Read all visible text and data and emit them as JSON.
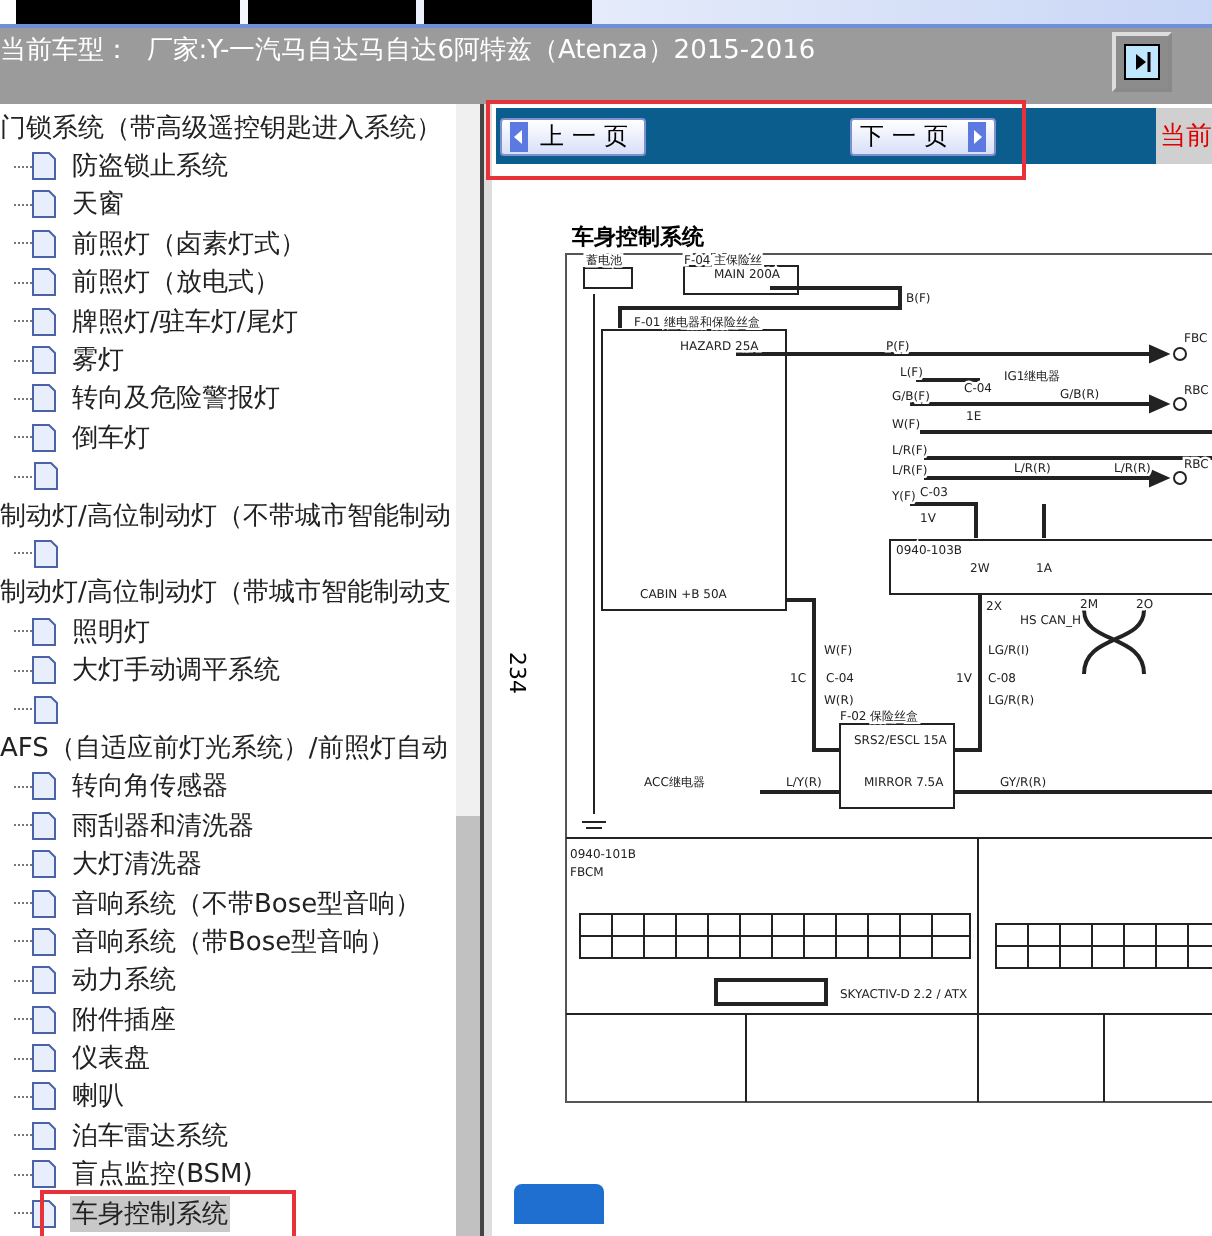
{
  "header": {
    "title": "当前车型：  厂家:Y-一汽马自达马自达6阿特兹（Atenza）2015-2016"
  },
  "tree": [
    {
      "label": "门锁系统（带高级遥控钥匙进入系统）",
      "children": [
        {
          "label": "防盗锁止系统",
          "selected": false,
          "highlighted": false
        },
        {
          "label": "天窗",
          "selected": false,
          "highlighted": false
        },
        {
          "label": "前照灯（卤素灯式）",
          "selected": false,
          "highlighted": false
        },
        {
          "label": "前照灯（放电式）",
          "selected": false,
          "highlighted": false
        },
        {
          "label": "牌照灯/驻车灯/尾灯",
          "selected": false,
          "highlighted": false
        },
        {
          "label": "雾灯",
          "selected": false,
          "highlighted": false
        },
        {
          "label": "转向及危险警报灯",
          "selected": false,
          "highlighted": false
        },
        {
          "label": "倒车灯",
          "selected": false,
          "highlighted": false
        },
        {
          "selected": false,
          "highlighted": false
        }
      ]
    },
    {
      "label": "制动灯/高位制动灯（不带城市智能制动",
      "children": [
        {
          "selected": false,
          "highlighted": false
        }
      ]
    },
    {
      "label": "制动灯/高位制动灯（带城市智能制动支",
      "children": [
        {
          "label": "照明灯",
          "selected": false,
          "highlighted": false
        },
        {
          "label": "大灯手动调平系统",
          "selected": false,
          "highlighted": false
        },
        {
          "selected": false,
          "highlighted": false
        }
      ]
    },
    {
      "label": "AFS（自适应前灯光系统）/前照灯自动",
      "children": [
        {
          "label": "转向角传感器",
          "selected": false,
          "highlighted": false
        },
        {
          "label": "雨刮器和清洗器",
          "selected": false,
          "highlighted": false
        },
        {
          "label": "大灯清洗器",
          "selected": false,
          "highlighted": false
        },
        {
          "label": "音响系统（不带Bose型音响）",
          "selected": false,
          "highlighted": false
        },
        {
          "label": "音响系统（带Bose型音响）",
          "selected": false,
          "highlighted": false
        },
        {
          "label": "动力系统",
          "selected": false,
          "highlighted": false
        },
        {
          "label": "附件插座",
          "selected": false,
          "highlighted": false
        },
        {
          "label": "仪表盘",
          "selected": false,
          "highlighted": false
        },
        {
          "label": "喇叭",
          "selected": false,
          "highlighted": false
        },
        {
          "label": "泊车雷达系统",
          "selected": false,
          "highlighted": false
        },
        {
          "label": "盲点监控(BSM)",
          "selected": false,
          "highlighted": false
        },
        {
          "label": "车身控制系统",
          "selected": true,
          "highlighted": true
        }
      ]
    }
  ],
  "nav": {
    "highlighted": true,
    "buttons": [
      {
        "label": "上一页",
        "kind": "prev"
      },
      {
        "label": "下一页",
        "kind": "next"
      }
    ],
    "status": "当前"
  },
  "diagram": {
    "title": "车身控制系统",
    "page": "234",
    "labels": [
      "蓄电池",
      "F-04 主保险丝",
      "MAIN 200A",
      "B(F)",
      "F-01 继电器和保险丝盒",
      "HAZARD 25A",
      "P(F)",
      "L(F)",
      "IG1继电器",
      "G/B(F)",
      "C-04",
      "1E",
      "G/B(R)",
      "W(F)",
      "L/R(F)",
      "L/R(F)",
      "L/R(R)",
      "L/R(R)",
      "Y(F)",
      "C-03",
      "1V",
      "0940-103B",
      "2W",
      "1A",
      "CABIN +B 50A",
      "2X",
      "2M",
      "2O",
      "HS CAN_H",
      "W(F)",
      "1C",
      "C-04",
      "W(R)",
      "LG/R(I)",
      "1V",
      "C-08",
      "LG/R(R)",
      "F-02 保险丝盒",
      "SRS2/ESCL 15A",
      "ACC继电器",
      "L/Y(R)",
      "MIRROR 7.5A",
      "GY/R(R)",
      "0940-101B",
      "FBCM",
      "SKYACTIV-D 2.2 / ATX",
      "FBC",
      "RBC",
      "RBC"
    ]
  }
}
